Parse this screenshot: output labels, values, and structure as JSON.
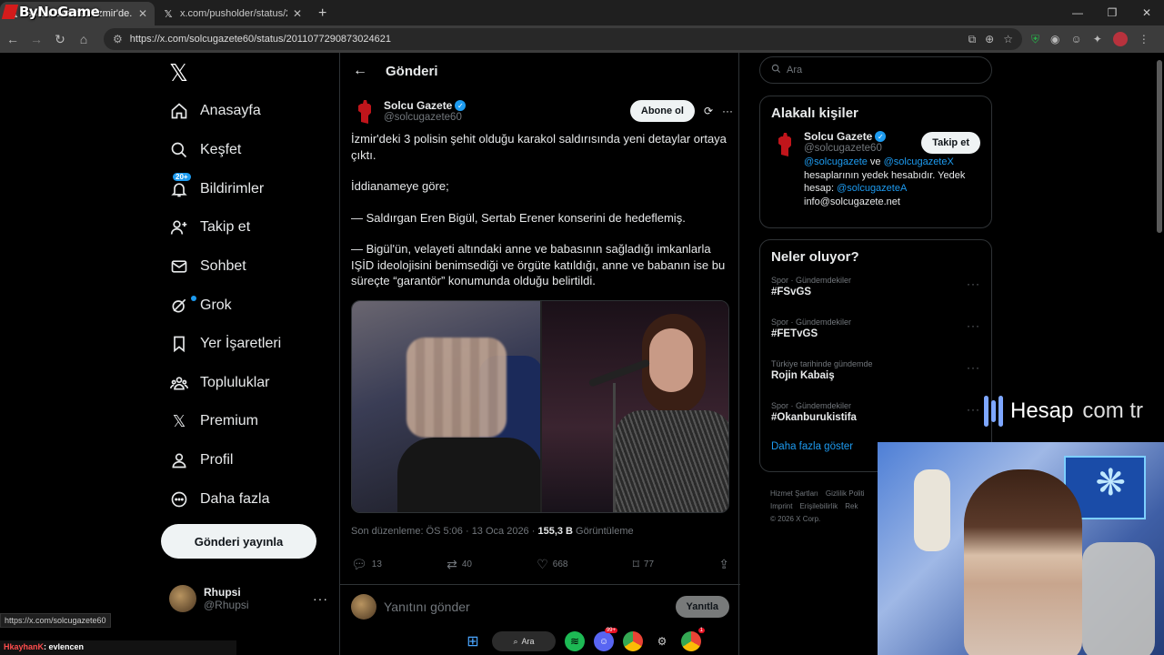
{
  "browser": {
    "tabs": [
      {
        "title": "Solcu Gazete: \"İzmir'de...",
        "active": true
      },
      {
        "title": "x.com/pusholder/status/20109...",
        "active": false
      }
    ],
    "new_tab": "+",
    "url": "https://x.com/solcugazete60/status/2011077290873024621",
    "watermark": "ByNoGame"
  },
  "nav": {
    "items": [
      {
        "label": "Anasayfa",
        "icon": "home-icon"
      },
      {
        "label": "Keşfet",
        "icon": "search-icon"
      },
      {
        "label": "Bildirimler",
        "icon": "bell-icon",
        "badge": "20+"
      },
      {
        "label": "Takip et",
        "icon": "add-user-icon"
      },
      {
        "label": "Sohbet",
        "icon": "mail-icon"
      },
      {
        "label": "Grok",
        "icon": "grok-icon"
      },
      {
        "label": "Yer İşaretleri",
        "icon": "bookmark-icon"
      },
      {
        "label": "Topluluklar",
        "icon": "communities-icon"
      },
      {
        "label": "Premium",
        "icon": "x-icon"
      },
      {
        "label": "Profil",
        "icon": "profile-icon"
      },
      {
        "label": "Daha fazla",
        "icon": "more-circle-icon"
      }
    ],
    "post_button": "Gönderi yayınla",
    "account": {
      "name": "Rhupsi",
      "handle": "@Rhupsi",
      "more": "···"
    }
  },
  "main": {
    "header_title": "Gönderi",
    "author": {
      "name": "Solcu Gazete",
      "handle": "@solcugazete60"
    },
    "subscribe_button": "Abone ol",
    "tweet": [
      "İzmir'deki 3 polisin şehit olduğu karakol saldırısında yeni detaylar ortaya çıktı.",
      "İddianameye göre;",
      "— Saldırgan Eren Bigül, Sertab Erener konserini de hedeflemiş.",
      "— Bigül'ün, velayeti altındaki anne ve babasının sağladığı imkanlarla IŞİD ideolojisini benimsediği ve örgüte katıldığı, anne ve babanın ise bu süreçte “garantör” konumunda olduğu belirtildi."
    ],
    "meta": {
      "prefix": "Son düzenleme: ÖS 5:06 · 13 Oca 2026 · ",
      "views": "155,3 B",
      "views_label": " Görüntüleme"
    },
    "actions": {
      "replies": "13",
      "reposts": "40",
      "likes": "668",
      "bookmarks": "77"
    },
    "reply_placeholder": "Yanıtını gönder",
    "reply_button": "Yanıtla"
  },
  "right": {
    "search_placeholder": "Ara",
    "related_title": "Alakalı kişiler",
    "related": {
      "name": "Solcu Gazete",
      "handle": "@solcugazete60",
      "follow": "Takip et",
      "bio_link1": "@solcugazete",
      "bio_mid": " ve ",
      "bio_link2": "@solcugazeteX",
      "bio_text": " hesaplarının yedek hesabıdır. Yedek hesap: ",
      "bio_link3": "@solcugazeteA",
      "bio_email": "info@solcugazete.net"
    },
    "trends_title": "Neler oluyor?",
    "trends": [
      {
        "context": "Spor · Gündemdekiler",
        "name": "#FSvGS"
      },
      {
        "context": "Spor · Gündemdekiler",
        "name": "#FETvGS"
      },
      {
        "context": "Türkiye tarihinde gündemde",
        "name": "Rojin Kabaiş"
      },
      {
        "context": "Spor · Gündemdekiler",
        "name": "#Okanburukistifa"
      }
    ],
    "show_more": "Daha fazla göster",
    "footer": [
      "Hizmet Şartları",
      "Gizlilik Politi",
      "Imprint",
      "Erişilebilirlik",
      "Rek",
      "© 2026 X Corp."
    ]
  },
  "overlay": {
    "hesap_brand": "Hesap",
    "hesap_suffix": "com tr",
    "status_url": "https://x.com/solcugazete60",
    "chat_user": "HkayhanK",
    "chat_text": ": evlencen"
  },
  "taskbar": {
    "search": "Ara",
    "discord_badge": "99+",
    "chrome_badge": "1"
  },
  "colors": {
    "accent": "#1d9bf0",
    "background": "#000000",
    "border": "#2f3336",
    "muted": "#71767b"
  }
}
